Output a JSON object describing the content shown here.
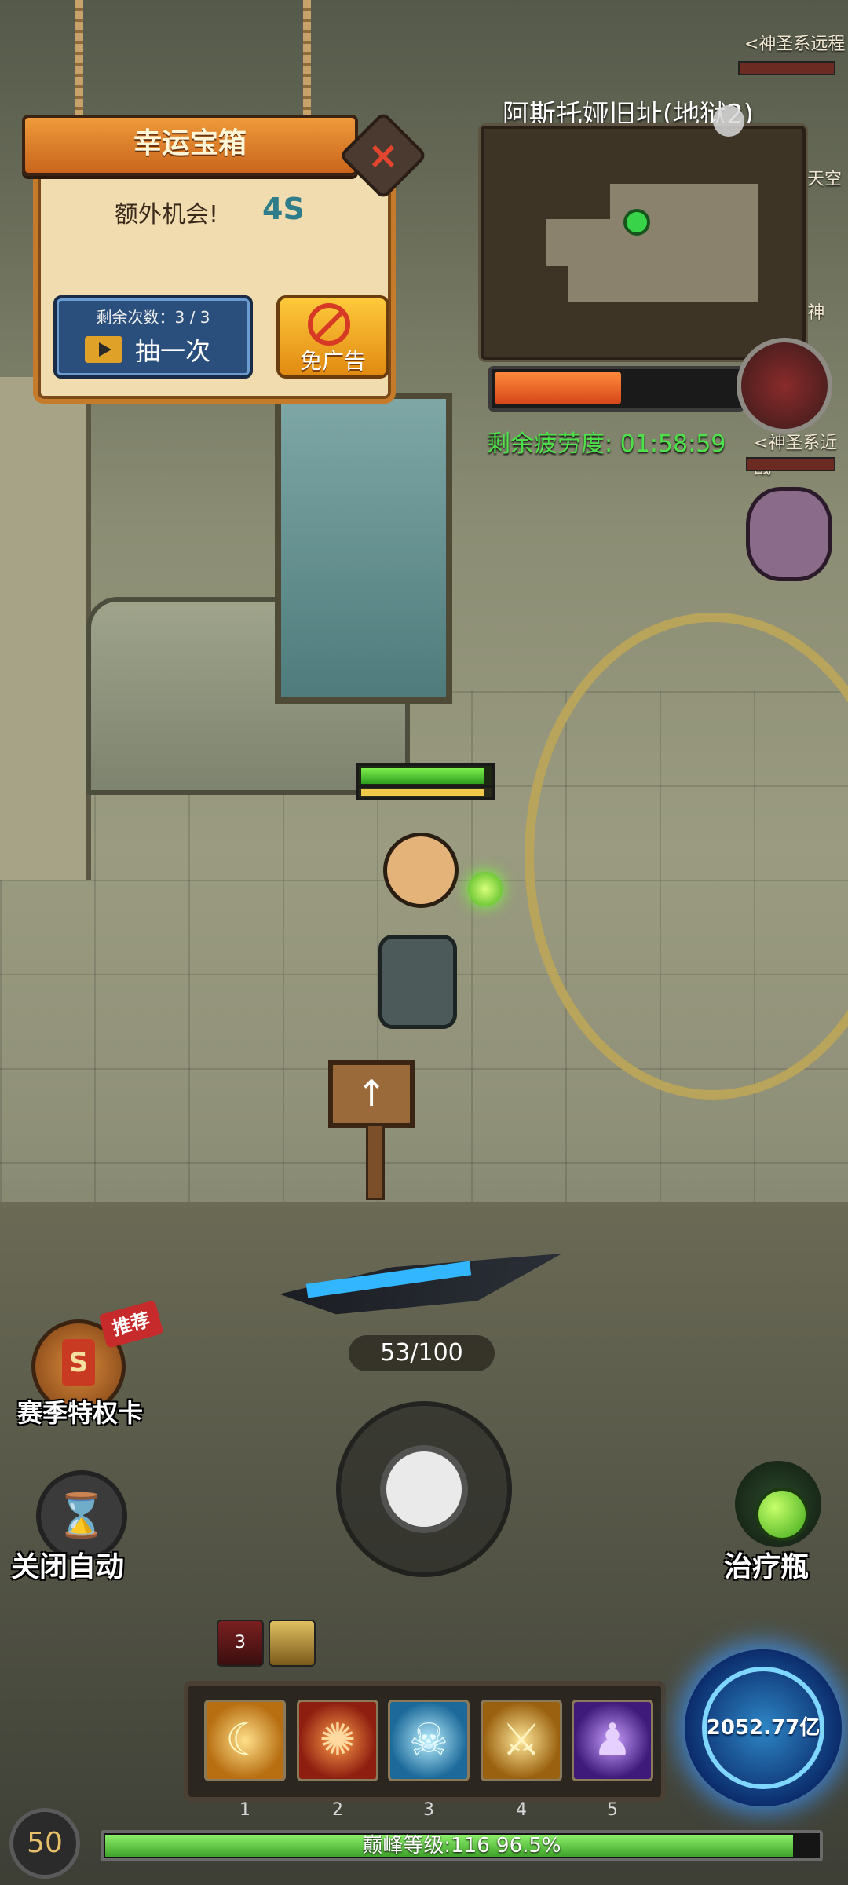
{
  "chest_panel": {
    "title": "幸运宝箱",
    "extra_chance_label": "额外机会!",
    "extra_chance_timer": "4S",
    "draw_remaining": "剩余次数：3 / 3",
    "draw_button_label": "抽一次",
    "no_ad_label": "免广告"
  },
  "minimap": {
    "area_name": "阿斯托娅旧址(地狱2)",
    "fatigue_label": "剩余疲劳度: 01:58:59",
    "fatigue_fraction": 0.52
  },
  "enemy_tags": [
    "<神圣系远程",
    "<神圣系近战",
    "<神",
    "天空"
  ],
  "player": {
    "hp_fraction": 0.95,
    "mp_fraction": 0.95
  },
  "weapon": {
    "progress": "53/100"
  },
  "side_buttons": {
    "season_card": "赛季特权卡",
    "recommend_badge": "推荐",
    "auto": "关闭自动",
    "potion": "治疗瓶"
  },
  "buffs": [
    {
      "count": "3"
    }
  ],
  "skills": [
    {
      "slot": "1",
      "icon": "golden-crescent-icon"
    },
    {
      "slot": "2",
      "icon": "fire-vortex-icon"
    },
    {
      "slot": "3",
      "icon": "ice-demon-icon"
    },
    {
      "slot": "4",
      "icon": "crossed-blades-icon"
    },
    {
      "slot": "5",
      "icon": "shadow-hood-icon"
    }
  ],
  "gold": {
    "value": "2052.77亿"
  },
  "level": {
    "number": "50",
    "text": "巅峰等级:116   96.5%",
    "fraction": 0.965
  },
  "colors": {
    "accent_orange": "#e8892a",
    "fatigue_green": "#4ee24a",
    "orb_blue": "#2e86c6"
  }
}
